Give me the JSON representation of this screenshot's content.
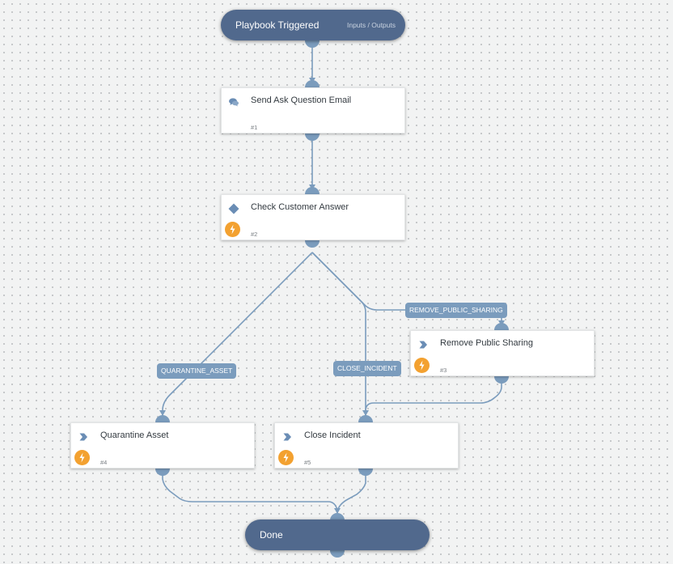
{
  "playbook": {
    "start": {
      "title": "Playbook Triggered",
      "io_link": "Inputs / Outputs"
    },
    "end": {
      "title": "Done"
    },
    "tasks": [
      {
        "id": "task-1",
        "name": "Send Ask Question Email",
        "number": "#1",
        "type_icon": "chat-bubbles-icon",
        "automated": false
      },
      {
        "id": "task-2",
        "name": "Check Customer Answer",
        "number": "#2",
        "type_icon": "diamond-condition-icon",
        "automated": true
      },
      {
        "id": "task-3",
        "name": "Remove Public Sharing",
        "number": "#3",
        "type_icon": "chevron-right-icon",
        "automated": true
      },
      {
        "id": "task-4",
        "name": "Quarantine Asset",
        "number": "#4",
        "type_icon": "chevron-right-icon",
        "automated": true
      },
      {
        "id": "task-5",
        "name": "Close Incident",
        "number": "#5",
        "type_icon": "chevron-right-icon",
        "automated": true
      }
    ],
    "branch_labels": {
      "remove_public_sharing": "REMOVE_PUBLIC_SHARING",
      "quarantine_asset": "QUARANTINE_ASSET",
      "close_incident": "CLOSE_INCIDENT"
    },
    "edges": [
      {
        "from": "start",
        "to": "task-1"
      },
      {
        "from": "task-1",
        "to": "task-2"
      },
      {
        "from": "task-2",
        "to": "task-3",
        "label": "REMOVE_PUBLIC_SHARING"
      },
      {
        "from": "task-2",
        "to": "task-4",
        "label": "QUARANTINE_ASSET"
      },
      {
        "from": "task-2",
        "to": "task-5",
        "label": "CLOSE_INCIDENT"
      },
      {
        "from": "task-3",
        "to": "task-5"
      },
      {
        "from": "task-4",
        "to": "end"
      },
      {
        "from": "task-5",
        "to": "end"
      }
    ],
    "colors": {
      "node_dark": "#51698d",
      "edge": "#7b9cbd",
      "automation_badge": "#f3a130"
    }
  }
}
